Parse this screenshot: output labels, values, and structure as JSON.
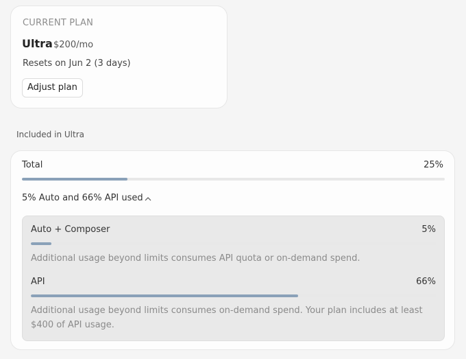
{
  "plan": {
    "eyebrow": "CURRENT PLAN",
    "name": "Ultra",
    "price": "$200/mo",
    "resets": "Resets on Jun 2 (3 days)",
    "adjust_label": "Adjust plan"
  },
  "included_label": "Included in Ultra",
  "usage": {
    "total": {
      "label": "Total",
      "percent_text": "25%",
      "fraction": 0.25
    },
    "toggle_label": "5% Auto and 66% API used",
    "breakdown": [
      {
        "label": "Auto + Composer",
        "percent_text": "5%",
        "fraction": 0.05,
        "note": "Additional usage beyond limits consumes API quota or on-demand spend."
      },
      {
        "label": "API",
        "percent_text": "66%",
        "fraction": 0.66,
        "note": "Additional usage beyond limits consumes on-demand spend. Your plan includes at least $400 of API usage."
      }
    ]
  },
  "colors": {
    "bar_fill": "#8aa1b8",
    "bar_track": "#e8e8e8"
  },
  "icons": {
    "toggle": "chevron-up-icon"
  }
}
